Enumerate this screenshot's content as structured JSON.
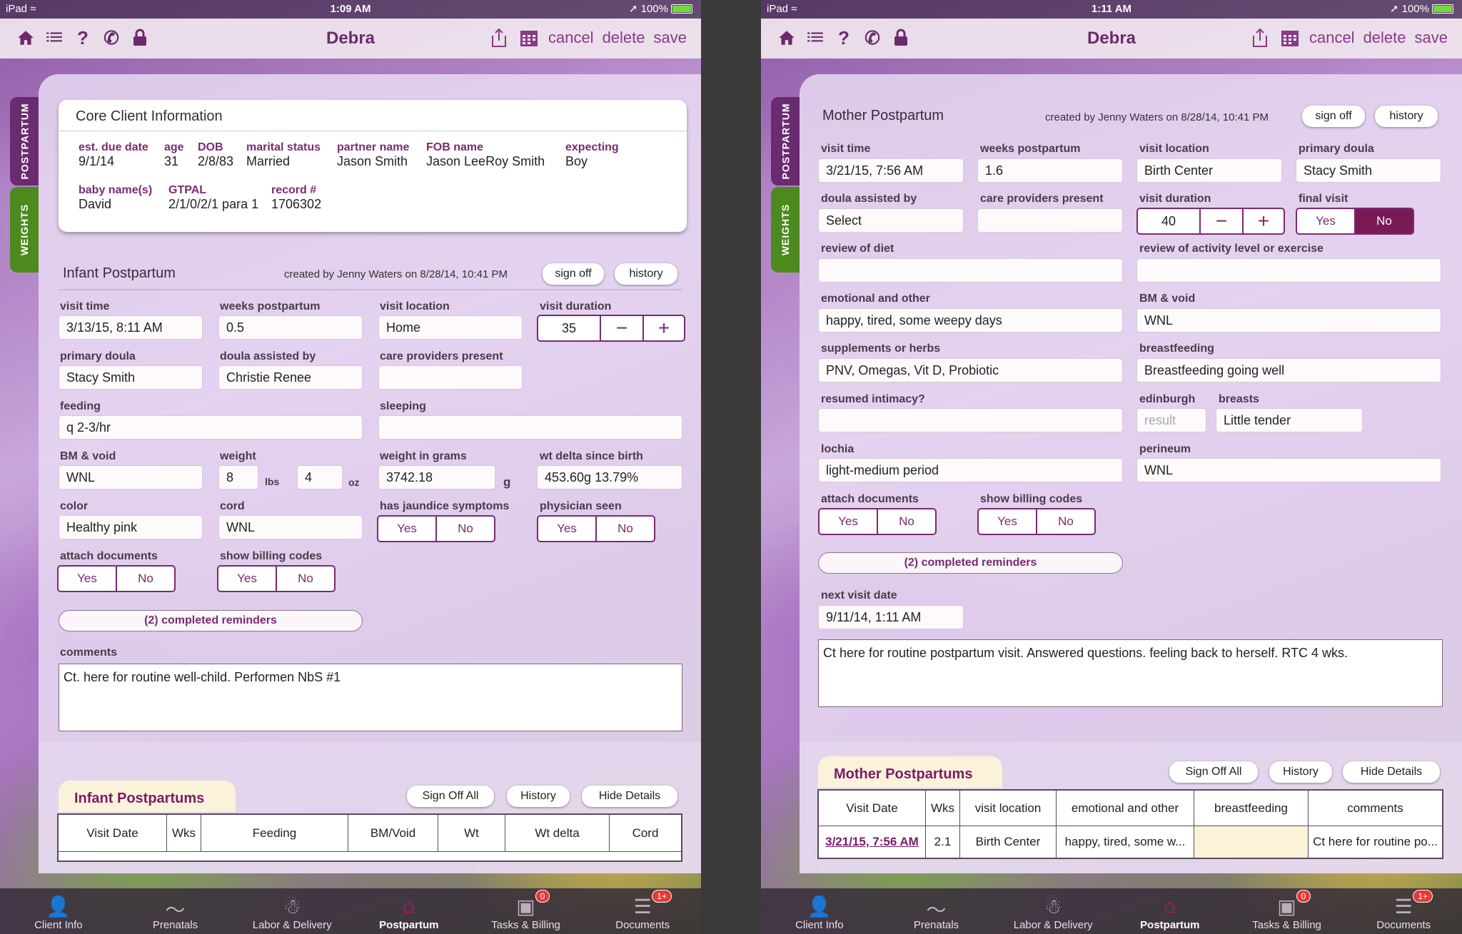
{
  "status": {
    "carrier": "iPad",
    "battery": "100%"
  },
  "left": {
    "time": "1:09 AM",
    "nav": {
      "title": "Debra",
      "cancel": "cancel",
      "delete": "delete",
      "save": "save"
    },
    "side_tabs": {
      "postpartum": "POSTPARTUM",
      "weights": "WEIGHTS"
    },
    "core": {
      "title": "Core Client Information",
      "due_label": "est. due date",
      "due": "9/1/14",
      "age_label": "age",
      "age": "31",
      "dob_label": "DOB",
      "dob": "2/8/83",
      "marital_label": "marital status",
      "marital": "Married",
      "partner_label": "partner name",
      "partner": "Jason Smith",
      "fob_label": "FOB name",
      "fob": "Jason LeeRoy Smith",
      "expecting_label": "expecting",
      "expecting": "Boy",
      "baby_label": "baby name(s)",
      "baby": "David",
      "gtpal_label": "GTPAL",
      "gtpal": "2/1/0/2/1 para 1",
      "record_label": "record #",
      "record": "1706302"
    },
    "section": {
      "title": "Infant Postpartum",
      "created": "created by Jenny Waters on 8/28/14, 10:41 PM",
      "sign_off": "sign off",
      "history": "history"
    },
    "form": {
      "visit_time_label": "visit time",
      "visit_time": "3/13/15, 8:11 AM",
      "weeks_label": "weeks postpartum",
      "weeks": "0.5",
      "location_label": "visit location",
      "location": "Home",
      "duration_label": "visit duration",
      "duration": "35",
      "doula_label": "primary doula",
      "doula": "Stacy Smith",
      "assisted_label": "doula assisted by",
      "assisted": "Christie Renee",
      "care_label": "care providers present",
      "care": "",
      "feeding_label": "feeding",
      "feeding": "q 2-3/hr",
      "sleeping_label": "sleeping",
      "sleeping": "",
      "bm_label": "BM & void",
      "bm": "WNL",
      "weight_label": "weight",
      "lbs": "8",
      "lbs_unit": "lbs",
      "oz": "4",
      "oz_unit": "oz",
      "grams_label": "weight in grams",
      "grams": "3742.18",
      "grams_unit": "g",
      "delta_label": "wt delta since birth",
      "delta": "453.60g 13.79%",
      "color_label": "color",
      "color": "Healthy pink",
      "cord_label": "cord",
      "cord": "WNL",
      "jaundice_label": "has jaundice symptoms",
      "physician_label": "physician seen",
      "attach_label": "attach documents",
      "billing_label": "show billing codes",
      "yes": "Yes",
      "no": "No",
      "reminders": "(2) completed reminders",
      "comments_label": "comments",
      "comments": "Ct. here for routine well-child.  Performen NbS #1"
    },
    "list": {
      "title": "Infant Postpartums",
      "sign_off_all": "Sign Off All",
      "history": "History",
      "hide": "Hide Details",
      "columns": [
        "Visit Date",
        "Wks",
        "Feeding",
        "BM/Void",
        "Wt",
        "Wt delta",
        "Cord"
      ]
    }
  },
  "right": {
    "time": "1:11 AM",
    "nav": {
      "title": "Debra",
      "cancel": "cancel",
      "delete": "delete",
      "save": "save"
    },
    "side_tabs": {
      "postpartum": "POSTPARTUM",
      "weights": "WEIGHTS"
    },
    "section": {
      "title": "Mother Postpartum",
      "created": "created by Jenny Waters on 8/28/14, 10:41 PM",
      "sign_off": "sign off",
      "history": "history"
    },
    "form": {
      "visit_time_label": "visit time",
      "visit_time": "3/21/15, 7:56 AM",
      "weeks_label": "weeks postpartum",
      "weeks": "1.6",
      "location_label": "visit location",
      "location": "Birth Center",
      "doula_label": "primary doula",
      "doula": "Stacy Smith",
      "assisted_label": "doula assisted by",
      "assisted": "Select",
      "care_label": "care providers present",
      "care": "",
      "duration_label": "visit duration",
      "duration": "40",
      "final_label": "final visit",
      "diet_label": "review of diet",
      "diet": "",
      "activity_label": "review of activity level or exercise",
      "activity": "",
      "emotional_label": "emotional and other",
      "emotional": "happy, tired, some weepy days",
      "bm_label": "BM & void",
      "bm": "WNL",
      "supp_label": "supplements or herbs",
      "supp": "PNV, Omegas, Vit D, Probiotic",
      "breastfeeding_label": "breastfeeding",
      "breastfeeding": "Breastfeeding going well",
      "intimacy_label": "resumed intimacy?",
      "intimacy": "",
      "edinburgh_label": "edinburgh",
      "edinburgh_ph": "result",
      "breasts_label": "breasts",
      "breasts": "Little tender",
      "lochia_label": "lochia",
      "lochia": "light-medium period",
      "perineum_label": "perineum",
      "perineum": "WNL",
      "attach_label": "attach documents",
      "billing_label": "show billing codes",
      "yes": "Yes",
      "no": "No",
      "reminders": "(2) completed reminders",
      "next_label": "next visit date",
      "next": "9/11/14, 1:11 AM",
      "comments": "Ct here for routine postpartum visit.   Answered questions.  feeling back to herself.  RTC 4 wks."
    },
    "list": {
      "title": "Mother Postpartums",
      "sign_off_all": "Sign Off All",
      "history": "History",
      "hide": "Hide Details",
      "columns": [
        "Visit Date",
        "Wks",
        "visit location",
        "emotional and other",
        "breastfeeding",
        "comments"
      ],
      "row": [
        "3/21/15, 7:56 AM",
        "2.1",
        "Birth Center",
        "happy, tired, some w...",
        "",
        "Ct here for routine po..."
      ]
    }
  },
  "tabbar": {
    "items": [
      "Client Info",
      "Prenatals",
      "Labor & Delivery",
      "Postpartum",
      "Tasks & Billing",
      "Documents"
    ],
    "active": "Postpartum",
    "tasks_badge": "0",
    "docs_badge": "1+"
  },
  "colors": {
    "accent": "#7a2a72",
    "selected": "#7a1a55",
    "tab_postpartum": "#6a2b70",
    "tab_weights": "#4c8a1e",
    "badge": "#e53935"
  }
}
